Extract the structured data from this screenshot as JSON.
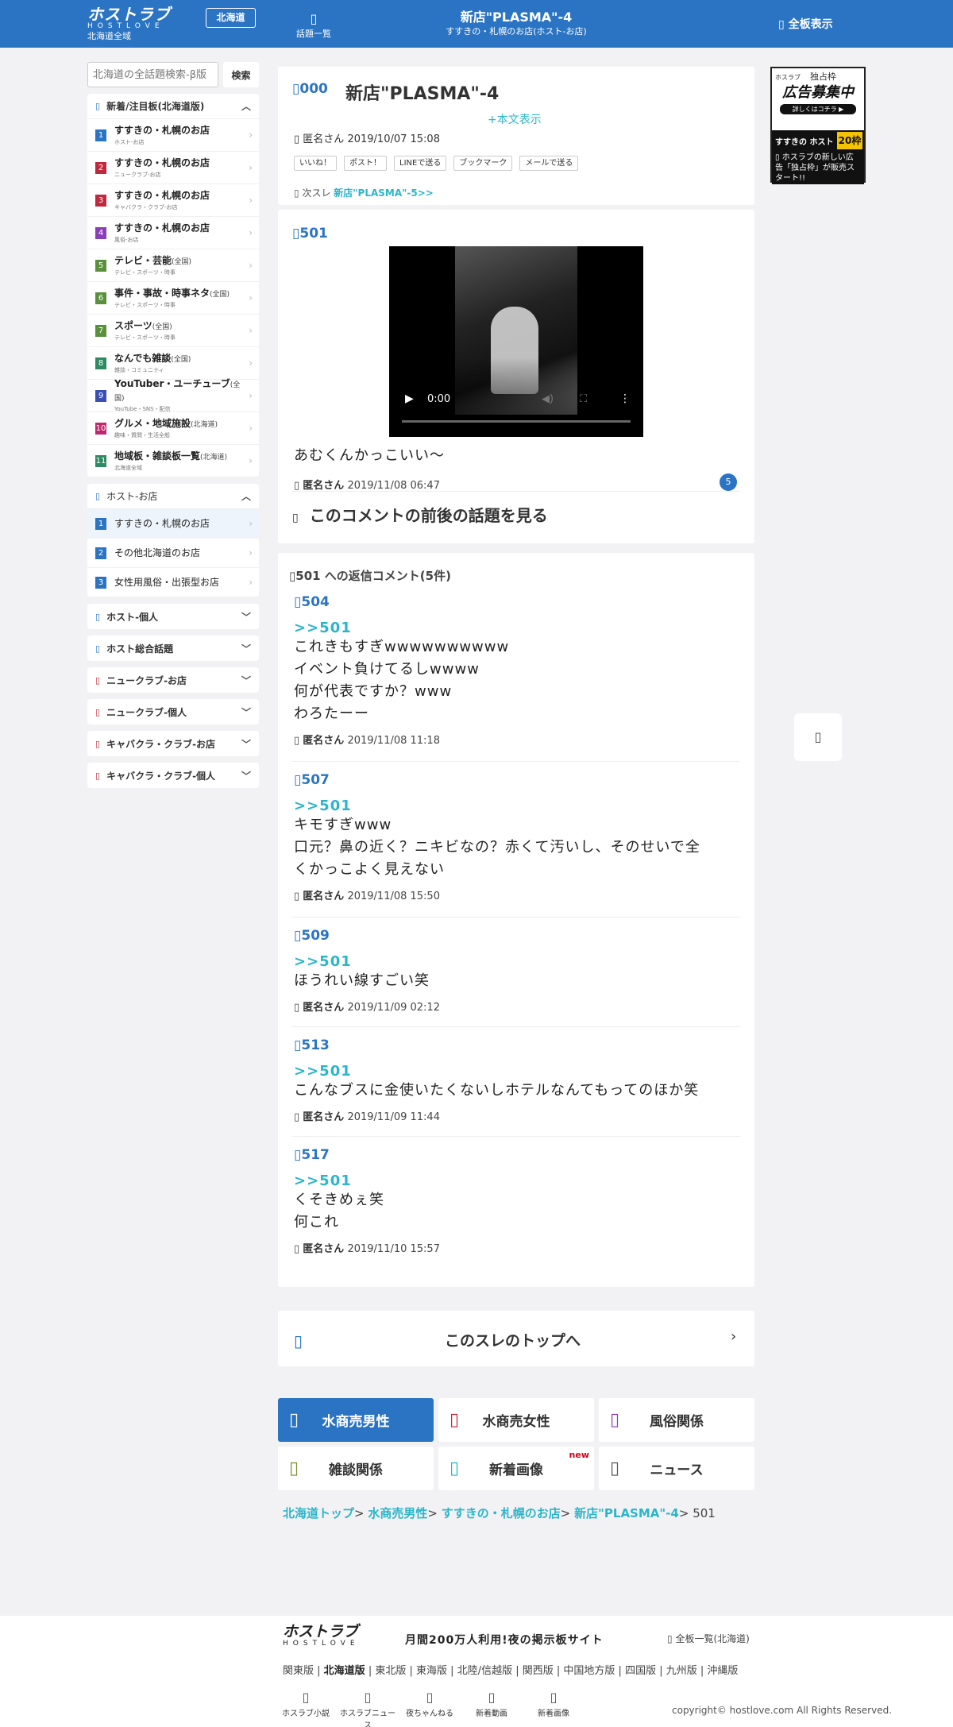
{
  "header": {
    "logo_jp": "ホストラブ",
    "logo_en": "HOSTLOVE",
    "area": "北海道全域",
    "region_button": "北海道",
    "threads_icon": "list-icon",
    "threads_label": "話題一覧",
    "title": "新店\"PLASMA\"-4",
    "subtitle": "すすきの・札幌のお店(ホスト-お店)",
    "all_boards": "全板表示"
  },
  "sidebar": {
    "search_placeholder": "北海道の全話題検索-β版",
    "search_button": "検索",
    "featured_title": "新着/注目板(北海道版)",
    "featured": [
      {
        "num": "1",
        "color": "#2b74c4",
        "label": "すすきの・札幌のお店",
        "scope": "",
        "sub": "ホスト-お店"
      },
      {
        "num": "2",
        "color": "#c0283c",
        "label": "すすきの・札幌のお店",
        "scope": "",
        "sub": "ニュークラブ-お店"
      },
      {
        "num": "3",
        "color": "#c0283c",
        "label": "すすきの・札幌のお店",
        "scope": "",
        "sub": "キャバクラ・クラブ-お店"
      },
      {
        "num": "4",
        "color": "#8a3fb5",
        "label": "すすきの・札幌のお店",
        "scope": "",
        "sub": "風俗-お店"
      },
      {
        "num": "5",
        "color": "#5a8f3c",
        "label": "テレビ・芸能",
        "scope": "(全国)",
        "sub": "テレビ・スポーツ・時事"
      },
      {
        "num": "6",
        "color": "#5a8f3c",
        "label": "事件・事故・時事ネタ",
        "scope": "(全国)",
        "sub": "テレビ・スポーツ・時事"
      },
      {
        "num": "7",
        "color": "#5a8f3c",
        "label": "スポーツ",
        "scope": "(全国)",
        "sub": "テレビ・スポーツ・時事"
      },
      {
        "num": "8",
        "color": "#2e8a62",
        "label": "なんでも雑談",
        "scope": "(全国)",
        "sub": "雑談・コミュニティ"
      },
      {
        "num": "9",
        "color": "#3a4fb5",
        "label": "YouTuber・ユーチューブ",
        "scope": "(全国)",
        "sub": "YouTube・SNS・配信"
      },
      {
        "num": "10",
        "color": "#c0286e",
        "label": "グルメ・地域施設",
        "scope": "(北海道)",
        "sub": "趣味・質問・生活全般"
      },
      {
        "num": "11",
        "color": "#2e8a62",
        "label": "地域板・雑談板一覧",
        "scope": "(北海道)",
        "sub": "北海道全域"
      }
    ],
    "host_shop_title": "ホスト-お店",
    "host_shop": [
      {
        "num": "1",
        "label": "すすきの・札幌のお店"
      },
      {
        "num": "2",
        "label": "その他北海道のお店"
      },
      {
        "num": "3",
        "label": "女性用風俗・出張型お店"
      }
    ],
    "collapsed": [
      {
        "label": "ホスト-個人",
        "color": "#2b74c4"
      },
      {
        "label": "ホスト総合話題",
        "color": "#2b74c4"
      },
      {
        "label": "ニュークラブ-お店",
        "color": "#c0283c"
      },
      {
        "label": "ニュークラブ-個人",
        "color": "#c0283c"
      },
      {
        "label": "キャバクラ・クラブ-お店",
        "color": "#c0283c"
      },
      {
        "label": "キャバクラ・クラブ-個人",
        "color": "#c0283c"
      }
    ]
  },
  "thread": {
    "op_num": "000",
    "title": "新店\"PLASMA\"-4",
    "show_body": "+本文表示",
    "op_author": "匿名さん",
    "op_date": "2019/10/07 15:08",
    "shares": [
      "いいね！",
      "ポスト！",
      "LINEで送る",
      "ブックマーク",
      "メールで送る"
    ],
    "next_label": "次スレ",
    "next_link": "新店\"PLASMA\"-5>>"
  },
  "post": {
    "num": "501",
    "video_time": "0:00",
    "body": "あむくんかっこいい〜",
    "author": "匿名さん",
    "date": "2019/11/08 06:47",
    "reply_count": "5",
    "context_link": "このコメントの前後の話題を見る"
  },
  "replies": {
    "heading": "501 への返信コメント(5件)",
    "items": [
      {
        "num": "504",
        "anchor": ">>501",
        "lines": [
          "これきもすぎwwwwwwwwww",
          "イベント負けてるしwwww",
          "何が代表ですか？www",
          "わろたーー"
        ],
        "author": "匿名さん",
        "date": "2019/11/08 11:18"
      },
      {
        "num": "507",
        "anchor": ">>501",
        "lines": [
          "キモすぎwww",
          "口元？鼻の近く？ニキビなの？赤くて汚いし、そのせいで全",
          "くかっこよく見えない"
        ],
        "author": "匿名さん",
        "date": "2019/11/08 15:50"
      },
      {
        "num": "509",
        "anchor": ">>501",
        "lines": [
          "ほうれい線すごい笑"
        ],
        "author": "匿名さん",
        "date": "2019/11/09 02:12"
      },
      {
        "num": "513",
        "anchor": ">>501",
        "lines": [
          "こんなブスに金使いたくないしホテルなんてもってのほか笑"
        ],
        "author": "匿名さん",
        "date": "2019/11/09 11:44"
      },
      {
        "num": "517",
        "anchor": ">>501",
        "lines": [
          "くそきめぇ笑",
          "何これ"
        ],
        "author": "匿名さん",
        "date": "2019/11/10 15:57"
      }
    ]
  },
  "thread_top": "このスレのトップへ",
  "categories": [
    {
      "label": "水商売男性",
      "icon_color": "#ffffff",
      "primary": true,
      "new": ""
    },
    {
      "label": "水商売女性",
      "icon_color": "#c0283c",
      "primary": false,
      "new": ""
    },
    {
      "label": "風俗関係",
      "icon_color": "#8a3fb5",
      "primary": false,
      "new": ""
    },
    {
      "label": "雑談関係",
      "icon_color": "#7a8f2c",
      "primary": false,
      "new": ""
    },
    {
      "label": "新着画像",
      "icon_color": "#2cb5ca",
      "primary": false,
      "new": "new"
    },
    {
      "label": "ニュース",
      "icon_color": "#555555",
      "primary": false,
      "new": ""
    }
  ],
  "breadcrumb": {
    "links": [
      "北海道トップ",
      "水商売男性",
      "すすきの・札幌のお店",
      "新店\"PLASMA\"-4"
    ],
    "current": "501"
  },
  "ad": {
    "small": "ホスラブ",
    "tag": "独占枠",
    "big": "広告募集中",
    "pill": "詳しくはコチラ ▶",
    "strip": "すすきの ホスト",
    "strip_badge": "20枠",
    "caption": "ホスラブの新しい広告「独占枠」が販売スタート!!"
  },
  "footer": {
    "logo_jp": "ホストラブ",
    "logo_en": "HOSTLOVE",
    "tagline": "月間200万人利用!夜の掲示板サイト",
    "all_link": "全板一覧(北海道)",
    "regions": [
      "関東版",
      "北海道版",
      "東北版",
      "東海版",
      "北陸/信越版",
      "関西版",
      "中国地方版",
      "四国版",
      "九州版",
      "沖縄版"
    ],
    "links": [
      "ホスラブ小説",
      "ホスラブニュース",
      "夜ちゃんねる",
      "新着動画",
      "新着画像"
    ],
    "copyright": "copyright© hostlove.com All Rights Reserved."
  }
}
